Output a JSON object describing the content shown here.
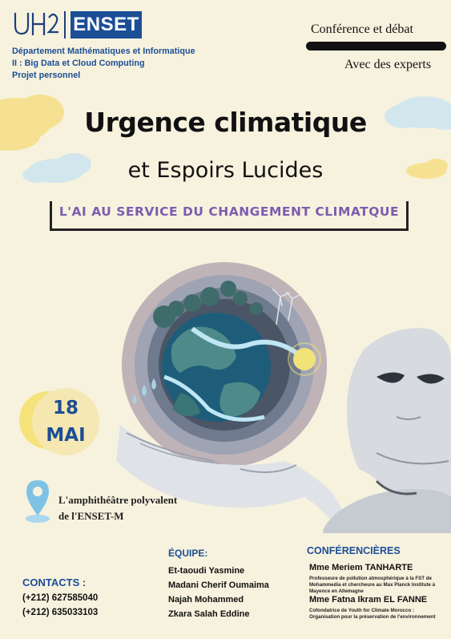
{
  "header": {
    "logo_text": "ENSET",
    "logo_mark": "UH2C",
    "department_lines": [
      "Département Mathématiques et Informatique",
      "II : Big Data et Cloud Computing",
      "Projet personnel"
    ],
    "event_type": "Conférence et débat",
    "event_subtype": "Avec des experts"
  },
  "titles": {
    "main": "Urgence climatique",
    "sub": "et Espoirs Lucides",
    "banner": "L'AI AU SERVICE DU CHANGEMENT CLIMATQUE"
  },
  "date": {
    "day": "18",
    "month": "MAI"
  },
  "venue": {
    "lines": [
      "L'amphithéâtre polyvalent",
      "de l'ENSET-M"
    ],
    "icon": "location-pin-icon"
  },
  "contacts": {
    "heading": "CONTACTS :",
    "phones": [
      "(+212) 627585040",
      "(+212) 635033103"
    ]
  },
  "team": {
    "heading": "ÉQUIPE:",
    "members": [
      "Et-taoudi Yasmine",
      "Madani Cherif Oumaima",
      "Najah Mohammed",
      "Zkara Salah Eddine"
    ]
  },
  "speakers": {
    "heading": "CONFÉRENCIÈRES",
    "items": [
      {
        "name": "Mme Meriem TANHARTE",
        "desc": "Professeure de pollution atmosphérique à la FST de Mohammedia et chercheure au Max Planck Institute à Mayence en Allemagne"
      },
      {
        "name": "Mme Fatna Ikram EL FANNE",
        "desc": "Cofondatrice de Youth for Climate Morocco : Organisation pour la préservation de l'environnement"
      }
    ]
  },
  "colors": {
    "brand_blue": "#1c4e96",
    "banner_purple": "#7c5cb0",
    "background": "#f7f2de",
    "date_yellow": "#f5e27a",
    "pin_blue": "#7ec3e6"
  }
}
